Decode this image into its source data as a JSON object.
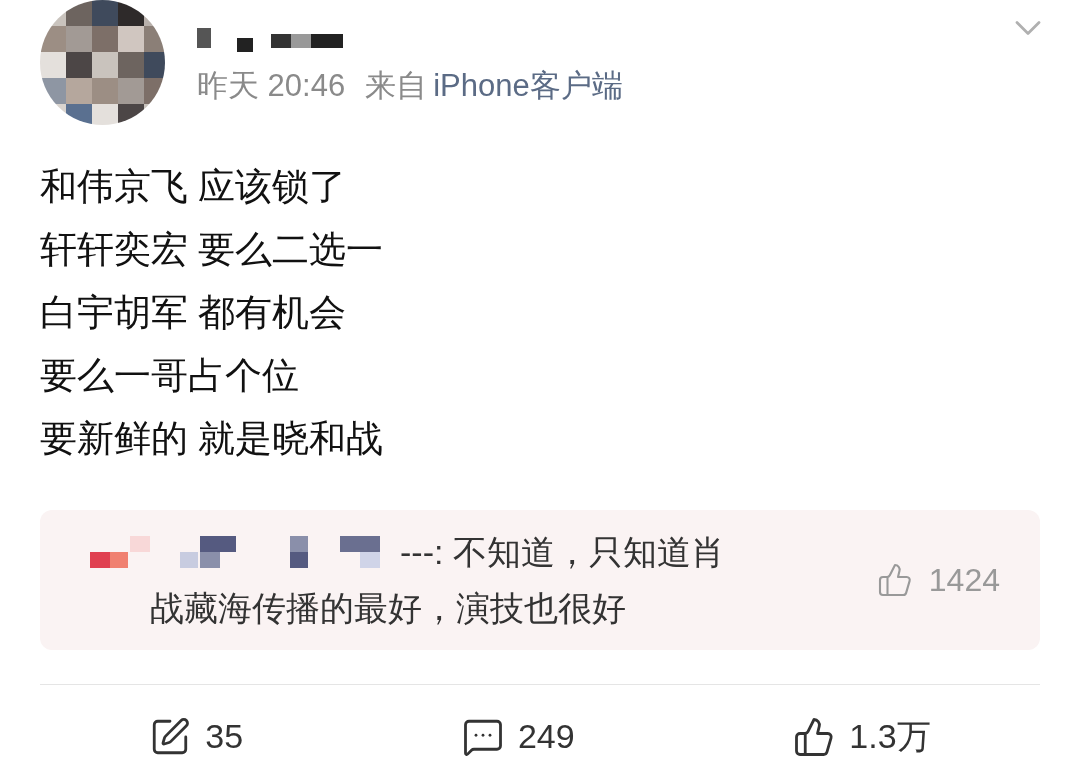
{
  "post": {
    "time": "昨天 20:46",
    "source_prefix": "来自",
    "source": "iPhone客户端",
    "lines": [
      "和伟京飞 应该锁了",
      "轩轩奕宏 要么二选一",
      "白宇胡军 都有机会",
      "要么一哥占个位",
      "要新鲜的 就是晓和战"
    ]
  },
  "hot_comment": {
    "lines": [
      "---: 不知道，只知道肖",
      "战藏海传播的最好，演技也很好"
    ],
    "likes": "1424"
  },
  "actions": [
    {
      "kind": "repost",
      "count": "35"
    },
    {
      "kind": "comment",
      "count": "249"
    },
    {
      "kind": "like",
      "count": "1.3万"
    }
  ]
}
